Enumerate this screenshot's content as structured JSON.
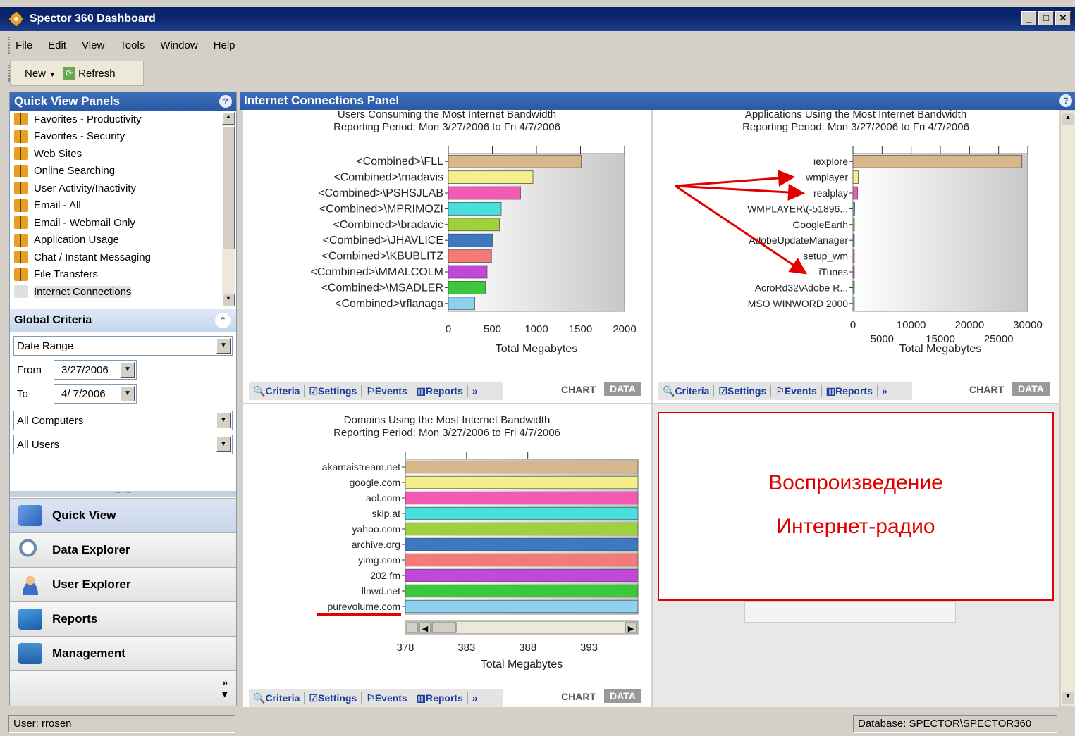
{
  "window": {
    "title": "Spector 360 Dashboard"
  },
  "menu": [
    "File",
    "Edit",
    "View",
    "Tools",
    "Window",
    "Help"
  ],
  "toolbar": {
    "new_label": "New",
    "refresh_label": "Refresh"
  },
  "quick_view": {
    "header": "Quick View Panels",
    "items": [
      "Favorites - Productivity",
      "Favorites - Security",
      "Web Sites",
      "Online Searching",
      "User Activity/Inactivity",
      "Email - All",
      "Email - Webmail Only",
      "Application Usage",
      "Chat / Instant Messaging",
      "File Transfers",
      "Internet Connections"
    ],
    "selected": "Internet Connections"
  },
  "global_criteria": {
    "header": "Global Criteria",
    "range_type": "Date Range",
    "from_label": "From",
    "from_value": "3/27/2006",
    "to_label": "To",
    "to_value": "4/ 7/2006",
    "computers": "All Computers",
    "users": "All Users"
  },
  "nav": [
    "Quick View",
    "Data Explorer",
    "User Explorer",
    "Reports",
    "Management"
  ],
  "main": {
    "header": "Internet Connections Panel"
  },
  "panel_tabs": {
    "criteria": "Criteria",
    "settings": "Settings",
    "events": "Events",
    "reports": "Reports",
    "more": "»",
    "chart": "CHART",
    "data": "DATA"
  },
  "chart_data": [
    {
      "type": "bar",
      "title": "Users Consuming the Most Internet Bandwidth",
      "subtitle": "Reporting Period: Mon 3/27/2006 to Fri 4/7/2006",
      "xlabel": "Total Megabytes",
      "categories": [
        "<Combined>\\FLL",
        "<Combined>\\madavis",
        "<Combined>\\PSHSJLAB",
        "<Combined>\\MPRIMOZI",
        "<Combined>\\bradavic",
        "<Combined>\\JHAVLICE",
        "<Combined>\\KBUBLITZ",
        "<Combined>\\MMALCOLM",
        "<Combined>\\MSADLER",
        "<Combined>\\rflanaga"
      ],
      "values": [
        1510,
        960,
        820,
        600,
        580,
        500,
        490,
        440,
        420,
        300
      ],
      "xlim": [
        0,
        2000
      ],
      "xticks": [
        "0",
        "500",
        "1000",
        "1500",
        "2000"
      ],
      "colors": [
        "#d8b88a",
        "#f4ef8a",
        "#f45ab4",
        "#48e0de",
        "#9ed23a",
        "#3d78c0",
        "#f47a7a",
        "#c248dc",
        "#3cc83c",
        "#8ed0f0"
      ]
    },
    {
      "type": "bar",
      "title": "Applications Using the Most Internet Bandwidth",
      "subtitle": "Reporting Period: Mon 3/27/2006 to Fri 4/7/2006",
      "xlabel": "Total Megabytes",
      "categories": [
        "iexplore",
        "wmplayer",
        "realplay",
        "WMPLAYER\\(-51896...",
        "GoogleEarth",
        "AdobeUpdateManager",
        "setup_wm",
        "iTunes",
        "AcroRd32\\Adobe R...",
        "MSO WINWORD 2000"
      ],
      "values": [
        29000,
        900,
        800,
        300,
        250,
        40,
        30,
        20,
        10,
        5
      ],
      "xlim": [
        0,
        30000
      ],
      "xticks_top": [
        "0",
        "10000",
        "20000",
        "30000"
      ],
      "xticks_bottom": [
        "5000",
        "15000",
        "25000"
      ],
      "colors": [
        "#d8b88a",
        "#f4ef8a",
        "#f45ab4",
        "#48e0de",
        "#9ed23a",
        "#3d78c0",
        "#f47a7a",
        "#c248dc",
        "#3cc83c",
        "#8ed0f0"
      ]
    },
    {
      "type": "bar",
      "title": "Domains Using the Most Internet Bandwidth",
      "subtitle": "Reporting Period: Mon 3/27/2006 to Fri 4/7/2006",
      "xlabel": "Total Megabytes",
      "categories": [
        "akamaistream.net",
        "google.com",
        "aol.com",
        "skip.at",
        "yahoo.com",
        "archive.org",
        "yimg.com",
        "202.fm",
        "llnwd.net",
        "purevolume.com"
      ],
      "values": [
        397,
        397,
        397,
        397,
        397,
        397,
        397,
        397,
        397,
        397
      ],
      "xlim": [
        378,
        397
      ],
      "xticks": [
        "378",
        "383",
        "388",
        "393"
      ],
      "colors": [
        "#d8b88a",
        "#f4ef8a",
        "#f45ab4",
        "#48e0de",
        "#9ed23a",
        "#3d78c0",
        "#f47a7a",
        "#c248dc",
        "#3cc83c",
        "#8ed0f0"
      ]
    }
  ],
  "annotation": {
    "line1": "Воспроизведение",
    "line2": "Интернет-радио"
  },
  "status": {
    "user": "User: rrosen",
    "database": "Database: SPECTOR\\SPECTOR360"
  }
}
